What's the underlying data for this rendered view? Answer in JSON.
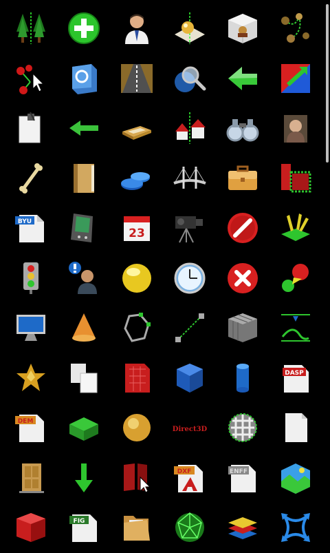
{
  "scrollbar": {
    "label": "vertical scrollbar"
  },
  "labels": {
    "byu": "BYU",
    "calendar_day": "23",
    "dasp": "DASP",
    "dem": "DEM",
    "direct3d": "Direct3D",
    "dxf": "DXF",
    "enff": "ENFF",
    "fig": "FIG"
  },
  "icons": [
    "trees-icon",
    "add-icon",
    "user-icon",
    "location-pin-icon",
    "cube-room-icon",
    "path-nodes-icon",
    "select-points-icon",
    "swap-faces-icon",
    "road-icon",
    "search-globe-icon",
    "back-arrow-icon",
    "flip-icon",
    "clip-paper-icon",
    "left-arrow-icon",
    "plate-icon",
    "houses-icon",
    "binoculars-icon",
    "portrait-icon",
    "bone-icon",
    "book-icon",
    "disks-icon",
    "bridge-icon",
    "briefcase-icon",
    "selection-icon",
    "byu-file-icon",
    "pda-icon",
    "calendar-icon",
    "video-camera-icon",
    "stop-icon",
    "lights-icon",
    "traffic-light-icon",
    "user-info-icon",
    "yellow-ball-icon",
    "clock-icon",
    "close-icon",
    "sphere-light-icon",
    "monitor-icon",
    "cone-icon",
    "polygon-icon",
    "line-segment-icon",
    "voxel-cube-icon",
    "spring-icon",
    "star-polyhedron-icon",
    "copy-icon",
    "red-document-icon",
    "blue-cube-icon",
    "cylinder-icon",
    "dasp-file-icon",
    "dem-file-icon",
    "green-box-icon",
    "gold-sphere-icon",
    "direct3d-icon",
    "checker-sphere-icon",
    "blank-file-icon",
    "door-icon",
    "down-arrow-icon",
    "red-doors-icon",
    "dxf-file-icon",
    "enff-file-icon",
    "landscape-icon",
    "red-cube-icon",
    "fig-file-icon",
    "folder-icon",
    "geodesic-sphere-icon",
    "layers-icon",
    "arrows-icon"
  ]
}
